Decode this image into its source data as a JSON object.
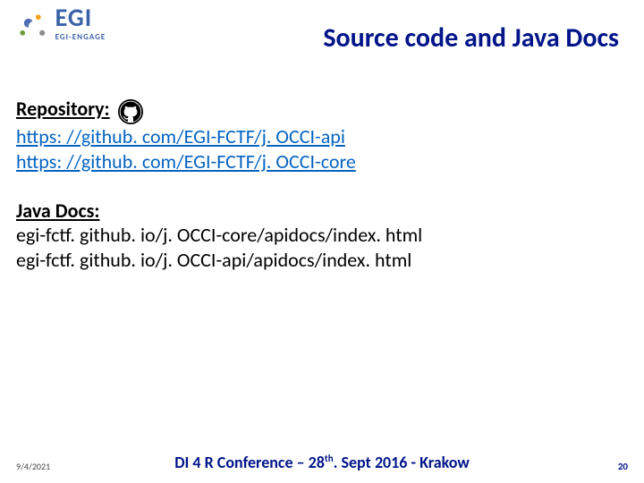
{
  "logo": {
    "name": "EGI",
    "tag": "EGI-ENGAGE"
  },
  "title": "Source code and Java Docs",
  "sections": {
    "repo": {
      "heading": "Repository:",
      "link1": "https: //github. com/EGI-FCTF/j. OCCI-api",
      "link2": "https: //github. com/EGI-FCTF/j. OCCI-core"
    },
    "javadocs": {
      "heading": "Java Docs:",
      "line1": "egi-fctf. github. io/j. OCCI-core/apidocs/index. html",
      "line2": "egi-fctf. github. io/j. OCCI-api/apidocs/index. html"
    }
  },
  "footer": {
    "date": "9/4/2021",
    "center_pre": "DI 4 R Conference – 28",
    "center_sup": "th",
    "center_post": ". Sept 2016 - Krakow",
    "page": "20"
  }
}
